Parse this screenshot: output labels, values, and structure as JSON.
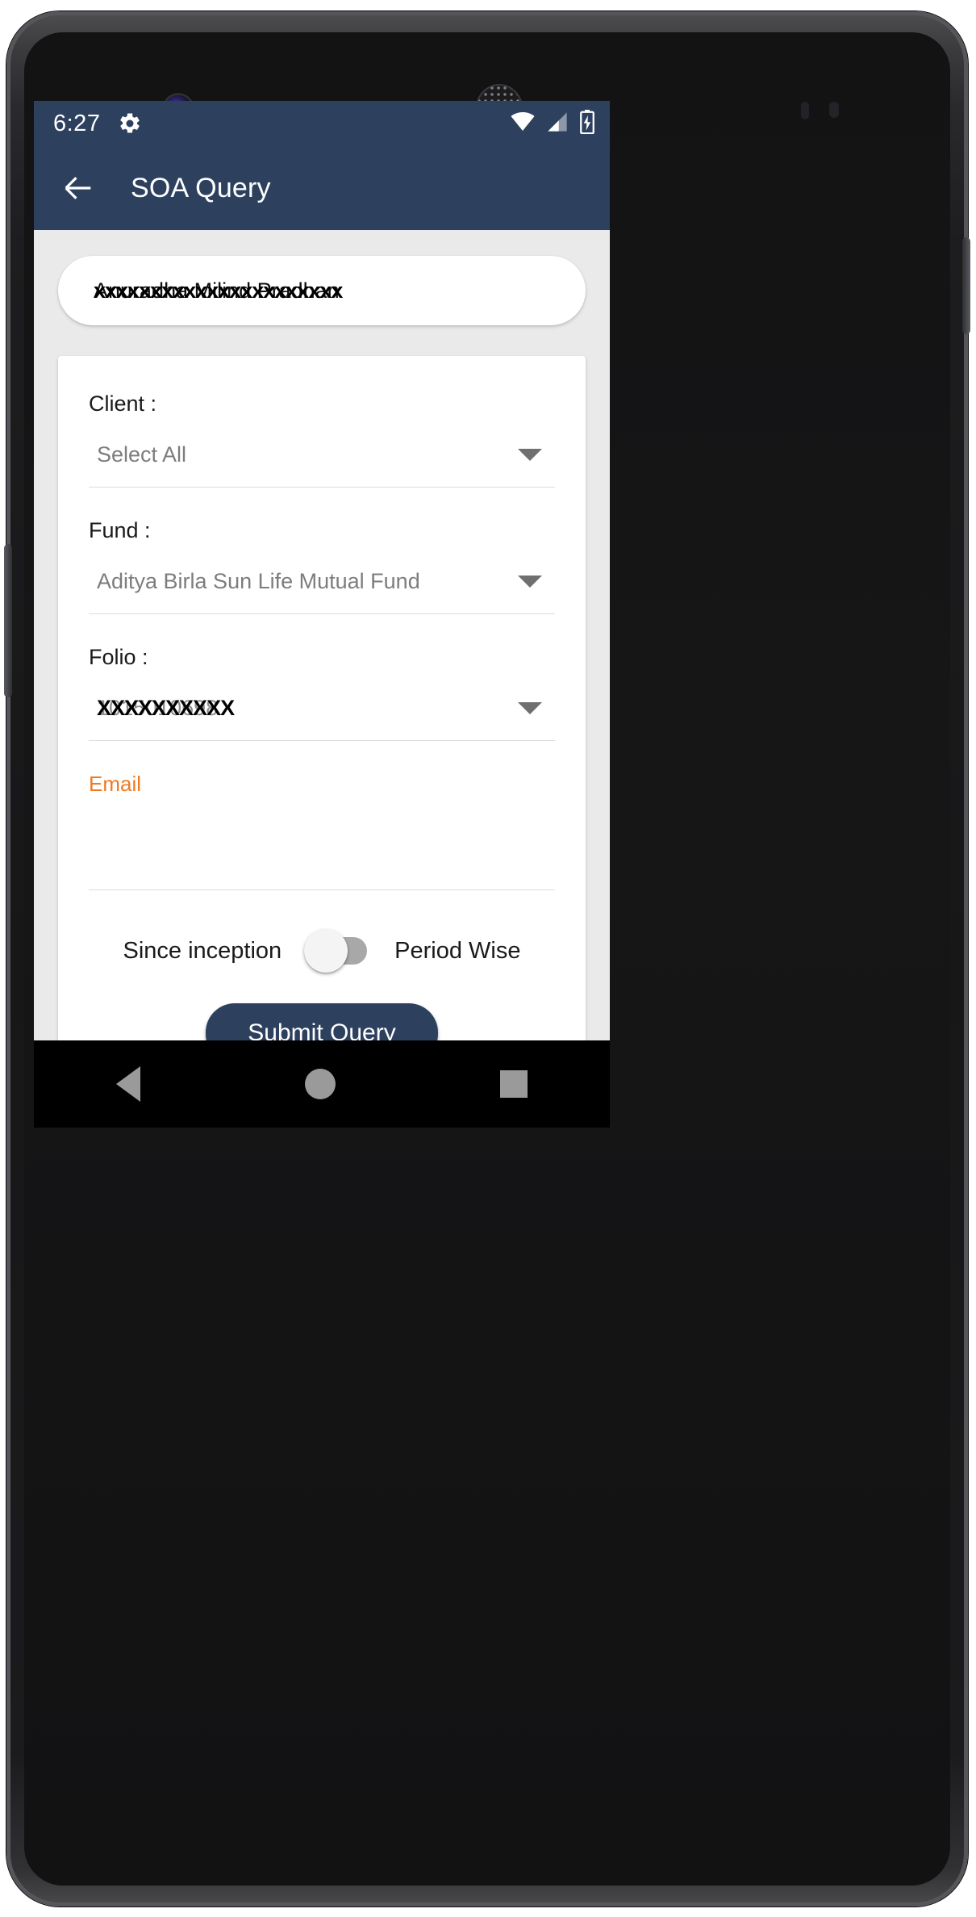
{
  "status_bar": {
    "clock": "6:27",
    "gear_icon": "gear-icon",
    "wifi_icon": "wifi-icon",
    "signal_icon": "cell-signal-icon",
    "battery_icon": "battery-charging-icon"
  },
  "app_bar": {
    "back_icon": "back-arrow-icon",
    "title": "SOA Query"
  },
  "name_pill": {
    "name": "Anuradha Milind Pradhan",
    "redaction_overlay": "xxxxxxxxxxxxxxxxxxxxxx"
  },
  "form": {
    "client": {
      "label": "Client :",
      "value": "Select All",
      "dropdown_icon": "chevron-down-icon"
    },
    "fund": {
      "label": "Fund :",
      "value": "Aditya Birla Sun Life Mutual Fund",
      "dropdown_icon": "chevron-down-icon"
    },
    "folio": {
      "label": "Folio :",
      "value": "1015010698",
      "redaction_overlay": "XXXXXXXXXX",
      "dropdown_icon": "chevron-down-icon"
    },
    "email": {
      "label": "Email",
      "value": "",
      "placeholder": ""
    },
    "period_toggle": {
      "left_label": "Since inception",
      "right_label": "Period Wise",
      "state": "off"
    },
    "submit_label": "Submit Query"
  },
  "nav_bar": {
    "back_icon": "nav-back-icon",
    "home_icon": "nav-home-icon",
    "recents_icon": "nav-recents-icon"
  },
  "colors": {
    "primary": "#2d415f",
    "accent_orange": "#ef7a21",
    "page_background": "#eaeaea",
    "card_background": "#ffffff"
  }
}
